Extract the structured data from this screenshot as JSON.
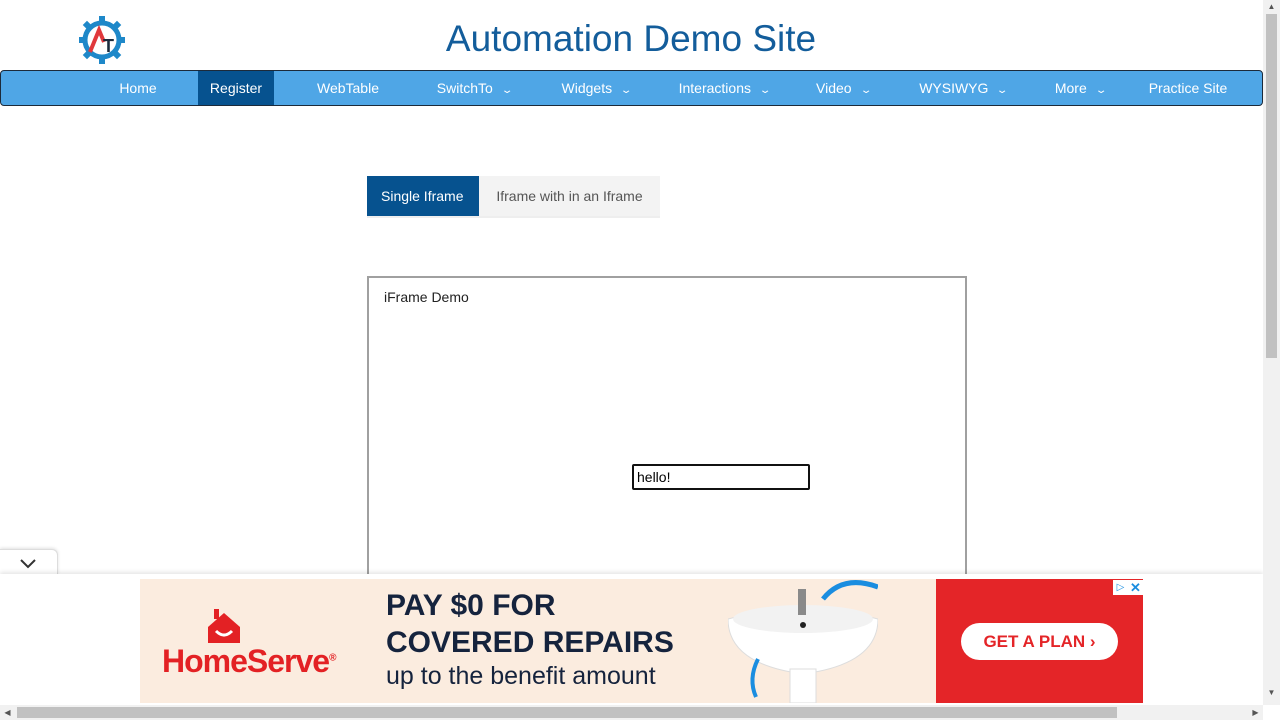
{
  "header": {
    "title": "Automation Demo Site",
    "logo_icon": "automation-testing-gear-logo"
  },
  "nav": {
    "items": [
      {
        "label": "Home",
        "dropdown": false
      },
      {
        "label": "Register",
        "dropdown": false,
        "active": true
      },
      {
        "label": "WebTable",
        "dropdown": false
      },
      {
        "label": "SwitchTo",
        "dropdown": true
      },
      {
        "label": "Widgets",
        "dropdown": true
      },
      {
        "label": "Interactions",
        "dropdown": true
      },
      {
        "label": "Video",
        "dropdown": true
      },
      {
        "label": "WYSIWYG",
        "dropdown": true
      },
      {
        "label": "More",
        "dropdown": true
      },
      {
        "label": "Practice Site",
        "dropdown": false
      }
    ]
  },
  "tabs": [
    {
      "label": "Single Iframe",
      "active": true
    },
    {
      "label": "Iframe with in an Iframe",
      "active": false
    }
  ],
  "iframe": {
    "title": "iFrame Demo",
    "input_value": "hello!"
  },
  "ad": {
    "brand": "HomeServe",
    "line1": "PAY $0 FOR",
    "line2": "COVERED REPAIRS",
    "line3": "up to the benefit amount",
    "cta": "GET A PLAN ›",
    "choices_icon": "adchoices-icon",
    "close_icon": "close-icon"
  },
  "colors": {
    "brand_blue": "#135d9b",
    "nav_bg": "#4fa6e6",
    "nav_active": "#06528f",
    "ad_red": "#e42528"
  }
}
